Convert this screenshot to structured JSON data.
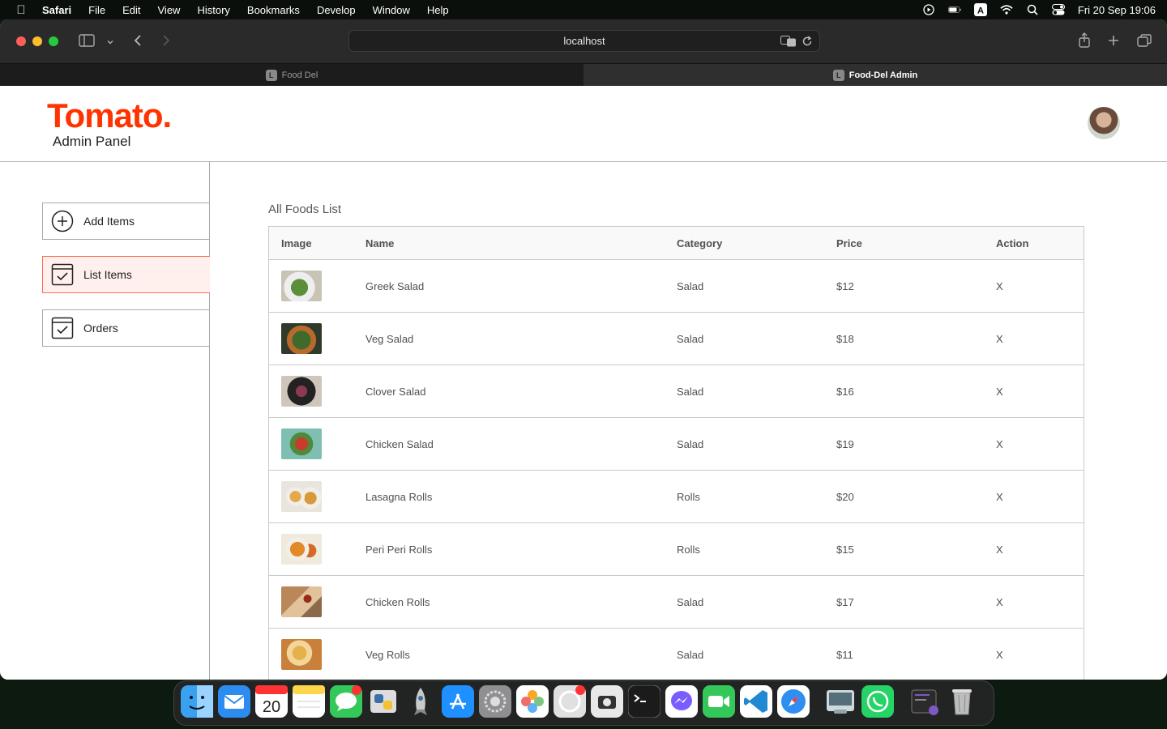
{
  "menubar": {
    "app": "Safari",
    "items": [
      "File",
      "Edit",
      "View",
      "History",
      "Bookmarks",
      "Develop",
      "Window",
      "Help"
    ],
    "clock": "Fri 20 Sep  19:06"
  },
  "browser": {
    "address": "localhost",
    "tabs": [
      {
        "label": "Food Del",
        "active": false
      },
      {
        "label": "Food-Del Admin",
        "active": true
      }
    ]
  },
  "header": {
    "logo": "Tomato.",
    "subtitle": "Admin Panel"
  },
  "sidebar": {
    "items": [
      {
        "label": "Add Items"
      },
      {
        "label": "List Items"
      },
      {
        "label": "Orders"
      }
    ]
  },
  "list": {
    "title": "All Foods List",
    "columns": [
      "Image",
      "Name",
      "Category",
      "Price",
      "Action"
    ],
    "rows": [
      {
        "name": "Greek Salad",
        "category": "Salad",
        "price": "$12",
        "action": "X"
      },
      {
        "name": "Veg Salad",
        "category": "Salad",
        "price": "$18",
        "action": "X"
      },
      {
        "name": "Clover Salad",
        "category": "Salad",
        "price": "$16",
        "action": "X"
      },
      {
        "name": "Chicken Salad",
        "category": "Salad",
        "price": "$19",
        "action": "X"
      },
      {
        "name": "Lasagna Rolls",
        "category": "Rolls",
        "price": "$20",
        "action": "X"
      },
      {
        "name": "Peri Peri Rolls",
        "category": "Rolls",
        "price": "$15",
        "action": "X"
      },
      {
        "name": "Chicken Rolls",
        "category": "Salad",
        "price": "$17",
        "action": "X"
      },
      {
        "name": "Veg Rolls",
        "category": "Salad",
        "price": "$11",
        "action": "X"
      }
    ]
  },
  "colors": {
    "brand": "#ff3300",
    "active_bg": "#fff0ed",
    "active_border": "#ff6a50"
  }
}
